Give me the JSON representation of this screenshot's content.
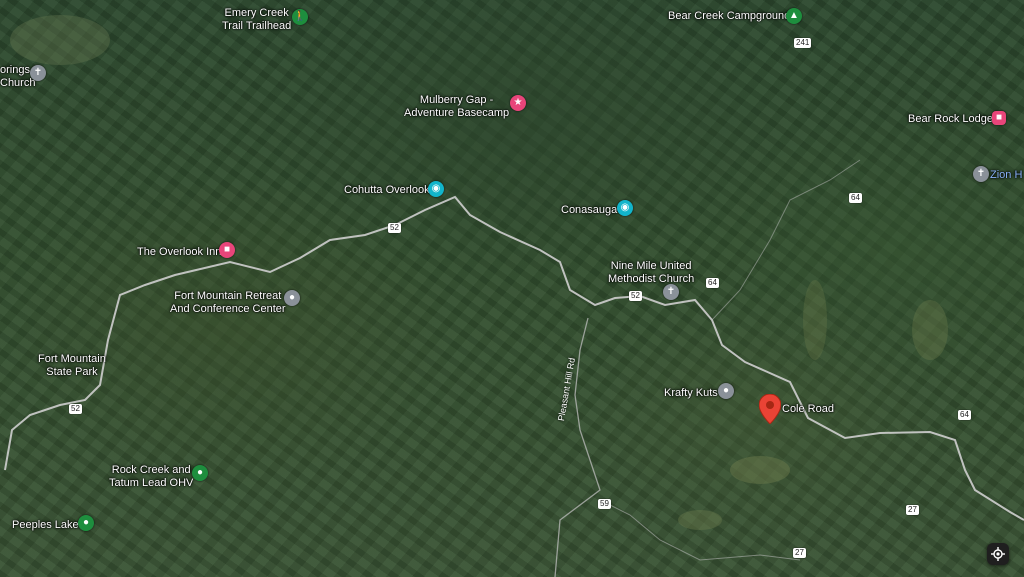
{
  "places": {
    "emery_creek": "Emery Creek\nTrail Trailhead",
    "bear_creek": "Bear Creek Campground",
    "springs_church": "orings\nChurch",
    "mulberry_gap": "Mulberry Gap -\nAdventure Basecamp",
    "bear_rock": "Bear Rock Lodge",
    "zion": "Zion H",
    "cohutta": "Cohutta Overlook",
    "conasauga": "Conasauga",
    "overlook_inn": "The Overlook Inn",
    "nine_mile": "Nine Mile United\nMethodist Church",
    "fort_mountain_retreat": "Fort Mountain Retreat\nAnd Conference Center",
    "fort_mountain_park": "Fort Mountain\nState Park",
    "krafty_kuts": "Krafty Kuts",
    "cole_road": "Cole Road",
    "rock_creek": "Rock Creek and\nTatum Lead OHV",
    "peeples": "Peeples Lake",
    "pleasant_hill_rd": "Pleasant Hill Rd"
  },
  "shields": {
    "s241": "241",
    "s64a": "64",
    "s52a": "52",
    "s52b": "52",
    "s64b": "64",
    "s52c": "52",
    "s64c": "64",
    "s59": "59",
    "s27a": "27",
    "s27b": "27"
  },
  "icons": {
    "hiking": "hiking-icon",
    "campground": "campground-icon",
    "church": "church-icon",
    "lodging": "lodging-icon",
    "viewpoint": "viewpoint-icon",
    "park": "park-icon",
    "location": "location-icon",
    "selected": "red-location-pin-icon",
    "recenter": "recenter-icon"
  },
  "colors": {
    "road": "#d9d9d9",
    "selected_pin": "#ea4335",
    "pink_poi": "#e8457a",
    "green_poi": "#1e8e3e",
    "blue_label": "#8ab4f8"
  }
}
